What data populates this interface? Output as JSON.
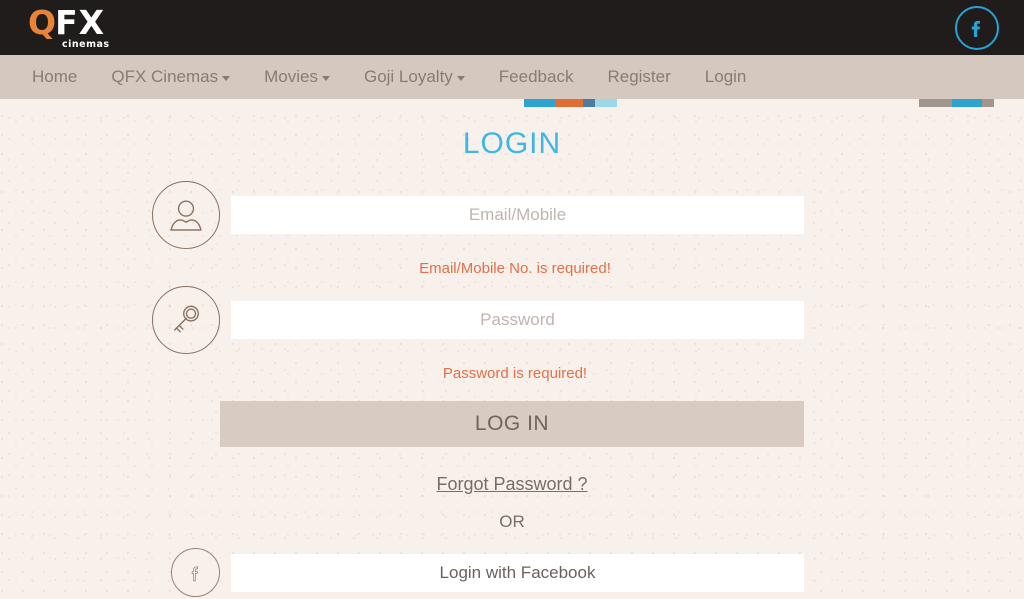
{
  "header": {
    "logo": {
      "mark_q": "Q",
      "mark_fx": "FX",
      "subtitle": "cinemas",
      "color_q": "#e8833a",
      "color_fx": "#ffffff"
    },
    "facebook_icon_label": "f",
    "facebook_icon_color": "#27a3d4",
    "background": "#201c1b"
  },
  "nav": {
    "background": "#d5c9bf",
    "text_color": "#857d77",
    "items": [
      {
        "label": "Home",
        "caret": false
      },
      {
        "label": "QFX Cinemas",
        "caret": true
      },
      {
        "label": "Movies",
        "caret": true
      },
      {
        "label": "Goji Loyalty",
        "caret": true
      },
      {
        "label": "Feedback",
        "caret": false
      },
      {
        "label": "Register",
        "caret": false
      },
      {
        "label": "Login",
        "caret": false
      }
    ]
  },
  "main": {
    "title": "LOGIN",
    "title_color": "#3fb7e5",
    "email_field": {
      "placeholder": "Email/Mobile",
      "value": "",
      "icon": "user-icon",
      "error": "Email/Mobile No. is required!"
    },
    "password_field": {
      "placeholder": "Password",
      "value": "",
      "icon": "key-icon",
      "error": "Password is required!"
    },
    "error_color": "#e0714a",
    "login_button": "LOG IN",
    "login_button_color": "#d8cbc1",
    "forgot_password": "Forgot Password ?",
    "or_divider": "OR",
    "facebook_login": {
      "label": "Login with Facebook",
      "icon": "facebook-icon",
      "icon_glyph": "f"
    }
  },
  "page": {
    "background": "#f8f0ea"
  }
}
